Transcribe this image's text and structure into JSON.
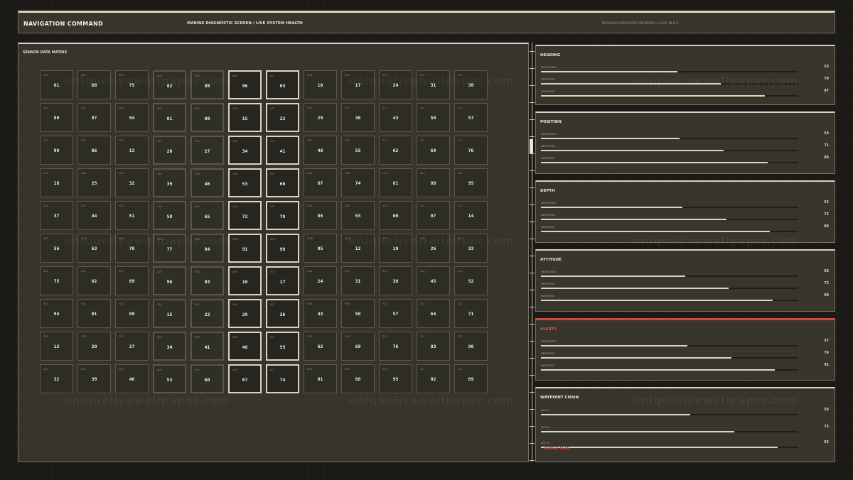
{
  "header": {
    "title": "NAVIGATION COMMAND",
    "subtitle": "MARINE DIAGNOSTIC SCREEN / LIVE SYSTEM HEALTH",
    "legend": "MEASURED  REPORTED  INFERRED  /  LOOP 38.8 S"
  },
  "matrix": {
    "title": "SENSOR DATA MATRIX",
    "rows": [
      {
        "ids": [
          "R01",
          "R02",
          "R03",
          "R04",
          "R05",
          "R06",
          "R07",
          "R08",
          "R09",
          "R10",
          "R11",
          "R12"
        ],
        "values": [
          "61",
          "68",
          "75",
          "82",
          "89",
          "96",
          "03",
          "10",
          "17",
          "24",
          "31",
          "38"
        ]
      },
      {
        "ids": [
          "S01",
          "S02",
          "S03",
          "S04",
          "S05",
          "S06",
          "S07",
          "S08",
          "S09",
          "S10",
          "S11",
          "S12"
        ],
        "values": [
          "80",
          "87",
          "94",
          "01",
          "08",
          "15",
          "22",
          "29",
          "36",
          "43",
          "50",
          "57"
        ]
      },
      {
        "ids": [
          "T01",
          "T02",
          "T03",
          "T04",
          "T05",
          "T06",
          "T07",
          "T08",
          "T09",
          "T10",
          "T11",
          "T12"
        ],
        "values": [
          "99",
          "06",
          "13",
          "20",
          "27",
          "34",
          "41",
          "48",
          "55",
          "62",
          "69",
          "76"
        ]
      },
      {
        "ids": [
          "U01",
          "U02",
          "U03",
          "U04",
          "U05",
          "U06",
          "U07",
          "U08",
          "U09",
          "U10",
          "U11",
          "U12"
        ],
        "values": [
          "18",
          "25",
          "32",
          "39",
          "46",
          "53",
          "60",
          "67",
          "74",
          "81",
          "88",
          "95"
        ]
      },
      {
        "ids": [
          "V01",
          "V02",
          "V03",
          "V04",
          "V05",
          "V06",
          "V07",
          "V08",
          "V09",
          "V10",
          "V11",
          "V12"
        ],
        "values": [
          "37",
          "44",
          "51",
          "58",
          "65",
          "72",
          "79",
          "86",
          "93",
          "00",
          "07",
          "14"
        ]
      },
      {
        "ids": [
          "W01",
          "W02",
          "W03",
          "W04",
          "W05",
          "W06",
          "W07",
          "W08",
          "W09",
          "W10",
          "W11",
          "W12"
        ],
        "values": [
          "56",
          "63",
          "70",
          "77",
          "84",
          "91",
          "98",
          "05",
          "12",
          "19",
          "26",
          "33"
        ]
      },
      {
        "ids": [
          "X01",
          "X02",
          "X03",
          "X04",
          "X05",
          "X06",
          "X07",
          "X08",
          "X09",
          "X10",
          "X11",
          "X12"
        ],
        "values": [
          "75",
          "82",
          "89",
          "96",
          "03",
          "10",
          "17",
          "24",
          "31",
          "38",
          "45",
          "52"
        ]
      },
      {
        "ids": [
          "Y01",
          "Y02",
          "Y03",
          "Y04",
          "Y05",
          "Y06",
          "Y07",
          "Y08",
          "Y09",
          "Y10",
          "Y11",
          "Y12"
        ],
        "values": [
          "94",
          "01",
          "08",
          "15",
          "22",
          "29",
          "36",
          "43",
          "50",
          "57",
          "64",
          "71"
        ]
      },
      {
        "ids": [
          "Z01",
          "Z02",
          "Z03",
          "Z04",
          "Z05",
          "Z06",
          "Z07",
          "Z08",
          "Z09",
          "Z10",
          "Z11",
          "Z12"
        ],
        "values": [
          "13",
          "20",
          "27",
          "34",
          "41",
          "48",
          "55",
          "62",
          "69",
          "76",
          "83",
          "90"
        ]
      },
      {
        "ids": [
          "A01",
          "A02",
          "A03",
          "A04",
          "A05",
          "A06",
          "A07",
          "A08",
          "A09",
          "A10",
          "A11",
          "A12"
        ],
        "values": [
          "32",
          "39",
          "46",
          "53",
          "60",
          "67",
          "74",
          "81",
          "88",
          "95",
          "02",
          "09"
        ]
      }
    ]
  },
  "panels": [
    {
      "title": "HEADING",
      "alert": false,
      "rows": [
        {
          "label": "MEASURED",
          "value": "53",
          "level": 0.53
        },
        {
          "label": "REPORTED",
          "value": "70",
          "level": 0.7
        },
        {
          "label": "INFERRED",
          "value": "87",
          "level": 0.87
        }
      ]
    },
    {
      "title": "POSITION",
      "alert": false,
      "rows": [
        {
          "label": "MEASURED",
          "value": "54",
          "level": 0.54
        },
        {
          "label": "REPORTED",
          "value": "71",
          "level": 0.71
        },
        {
          "label": "INFERRED",
          "value": "88",
          "level": 0.88
        }
      ]
    },
    {
      "title": "DEPTH",
      "alert": false,
      "rows": [
        {
          "label": "MEASURED",
          "value": "55",
          "level": 0.55
        },
        {
          "label": "REPORTED",
          "value": "72",
          "level": 0.72
        },
        {
          "label": "INFERRED",
          "value": "89",
          "level": 0.89
        }
      ]
    },
    {
      "title": "ATTITUDE",
      "alert": false,
      "rows": [
        {
          "label": "MEASURED",
          "value": "56",
          "level": 0.56
        },
        {
          "label": "REPORTED",
          "value": "73",
          "level": 0.73
        },
        {
          "label": "INFERRED",
          "value": "90",
          "level": 0.9
        }
      ]
    },
    {
      "title": "ALERTS",
      "alert": true,
      "rows": [
        {
          "label": "MEASURED",
          "value": "57",
          "level": 0.57
        },
        {
          "label": "REPORTED",
          "value": "74",
          "level": 0.74
        },
        {
          "label": "INFERRED",
          "value": "91",
          "level": 0.91
        }
      ]
    },
    {
      "title": "WAYPOINT CHAIN",
      "alert": false,
      "rows": [
        {
          "label": "WP-01",
          "value": "58",
          "level": 0.58
        },
        {
          "label": "WP-02",
          "value": "75",
          "level": 0.75
        },
        {
          "label": "WP-03",
          "value": "92",
          "level": 0.92
        }
      ],
      "flag": "RANGE FLAG"
    }
  ],
  "watermark": "uniquelivewallpaper.com",
  "colors": {
    "background": "#1b1a16",
    "panel": "#37352c",
    "accent": "#d9d4c4",
    "alert": "#c94a3f"
  }
}
